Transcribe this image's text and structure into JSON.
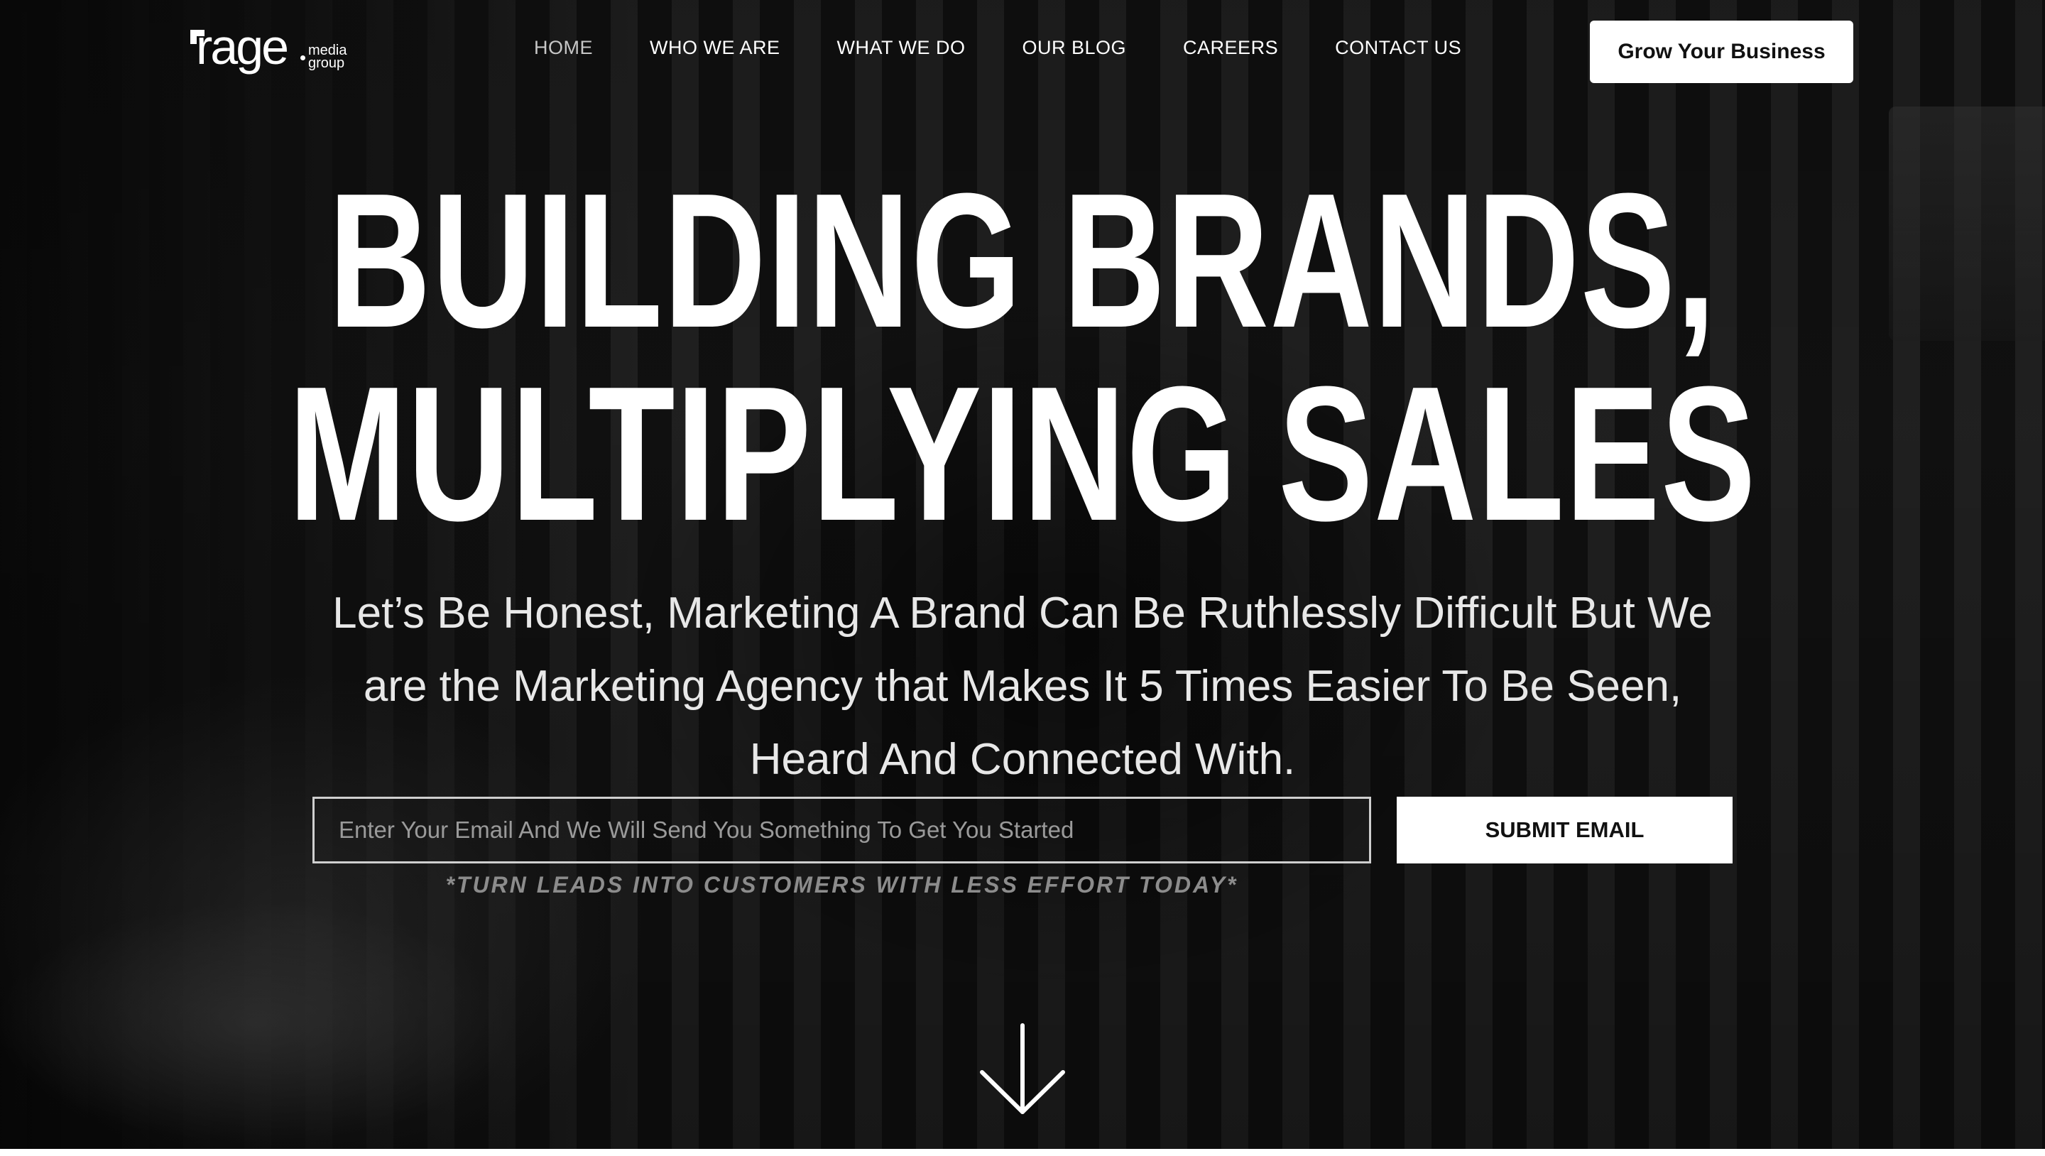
{
  "logo": {
    "word": "rage",
    "sub_line_1": "media",
    "sub_line_2": "group"
  },
  "nav": {
    "items": [
      {
        "label": "HOME",
        "active": true
      },
      {
        "label": "WHO WE ARE",
        "active": false
      },
      {
        "label": "WHAT WE DO",
        "active": false
      },
      {
        "label": "OUR BLOG",
        "active": false
      },
      {
        "label": "CAREERS",
        "active": false
      },
      {
        "label": "CONTACT US",
        "active": false
      }
    ]
  },
  "header": {
    "cta_label": "Grow Your Business"
  },
  "hero": {
    "headline_line_1": "BUILDING BRANDS,",
    "headline_line_2": "MULTIPLYING SALES",
    "subhead": "Let’s Be Honest, Marketing A Brand Can Be Ruthlessly Difficult But We are the Marketing Agency that Makes It 5 Times Easier To Be Seen, Heard And Connected With.",
    "email_placeholder": "Enter Your Email And We Will Send You Something To Get You Started",
    "email_value": "",
    "submit_label": "SUBMIT EMAIL",
    "tagline": "*TURN LEADS INTO CUSTOMERS WITH LESS EFFORT TODAY*"
  },
  "icons": {
    "scroll": "arrow-down-icon"
  },
  "colors": {
    "text_primary": "#ffffff",
    "nav_active": "#c7c7c7",
    "button_bg": "#ffffff",
    "button_text": "#111111",
    "tagline": "#8c8c8c"
  }
}
